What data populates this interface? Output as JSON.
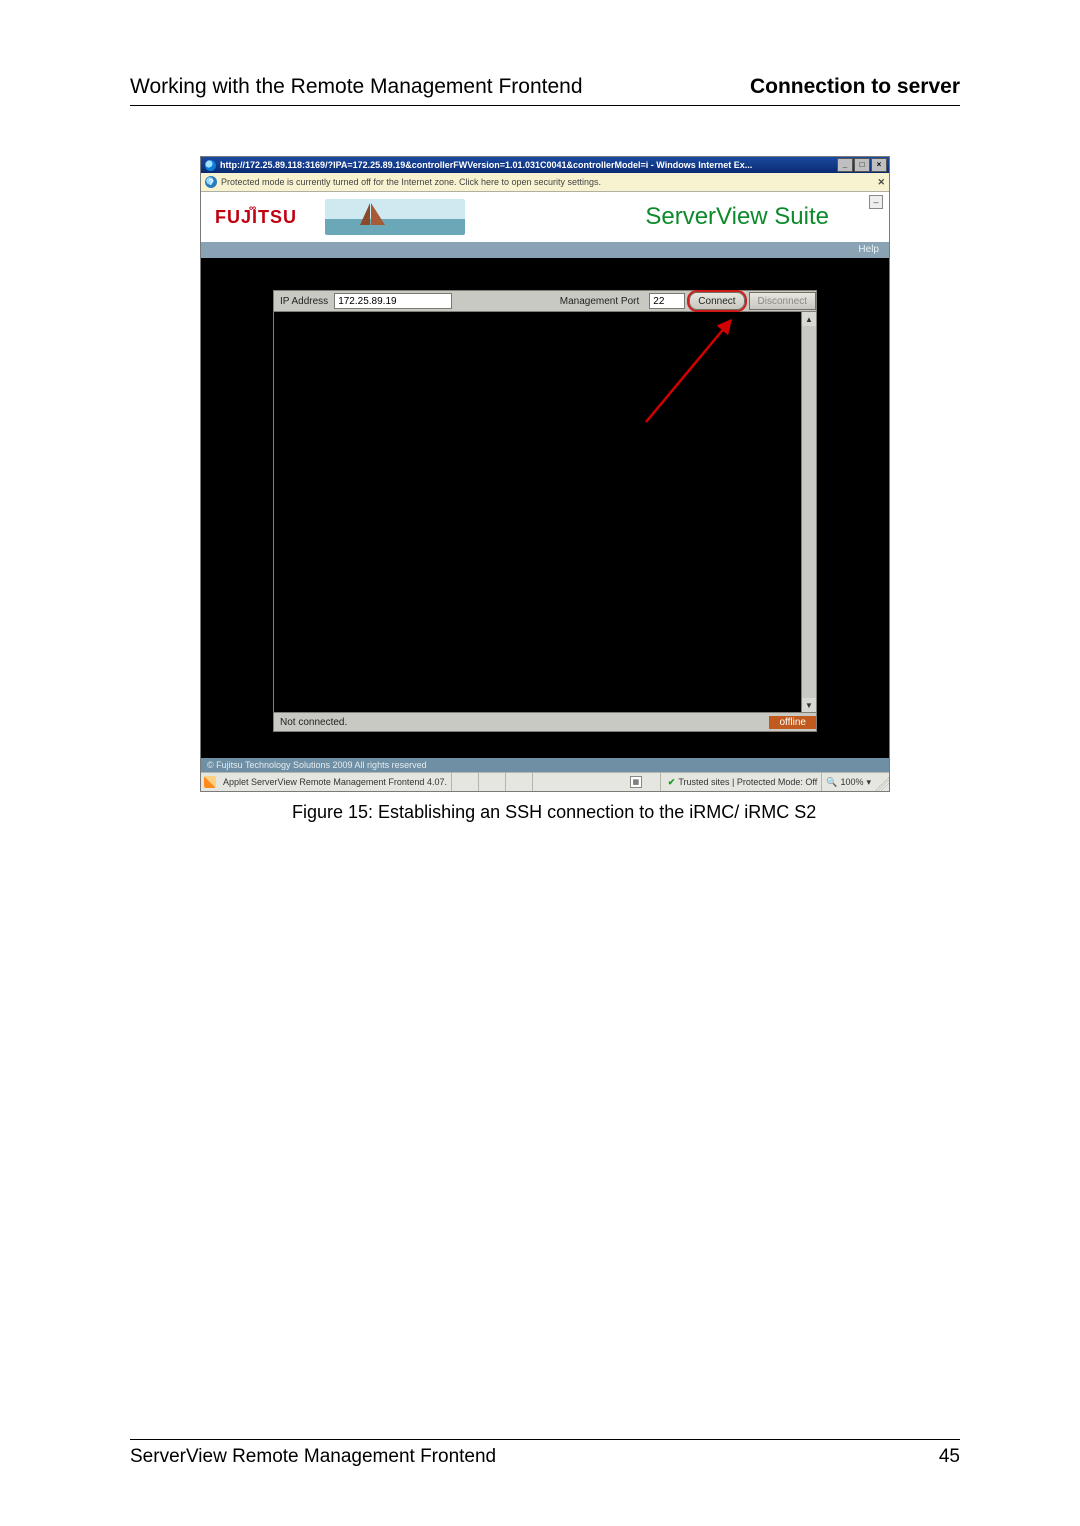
{
  "page_header": {
    "left": "Working with the Remote Management Frontend",
    "right": "Connection to server"
  },
  "window": {
    "title": "http://172.25.89.118:3169/?IPA=172.25.89.19&controllerFWVersion=1.01.031C0041&controllerModel=i - Windows Internet Ex...",
    "min_label": "_",
    "max_label": "□",
    "close_label": "×"
  },
  "infobar": {
    "text": "Protected mode is currently turned off for the Internet zone. Click here to open security settings.",
    "shield_glyph": "?",
    "close_glyph": "✕"
  },
  "brand": {
    "fujitsu": "FUJITSU",
    "suite": "ServerView Suite",
    "restore_glyph": "–"
  },
  "helpbar": {
    "help": "Help"
  },
  "toolbar": {
    "ip_label": "IP Address",
    "ip_value": "172.25.89.19",
    "port_label": "Management Port",
    "port_value": "22",
    "connect_label": "Connect",
    "disconnect_label": "Disconnect"
  },
  "scroll": {
    "up": "▲",
    "down": "▼"
  },
  "statusrow": {
    "left": "Not connected.",
    "right": "offline"
  },
  "copyright": "© Fujitsu Technology Solutions 2009  All rights reserved",
  "iestatus": {
    "applet": "Applet ServerView Remote Management Frontend 4.07.",
    "security": "Trusted sites | Protected Mode: Off",
    "zoom": "100%",
    "zoom_arrow": "▾",
    "mag_glyph": "🔍"
  },
  "figure_caption": "Figure 15: Establishing an SSH connection to the iRMC/ iRMC S2",
  "footer": {
    "left": "ServerView Remote Management Frontend",
    "right": "45"
  }
}
